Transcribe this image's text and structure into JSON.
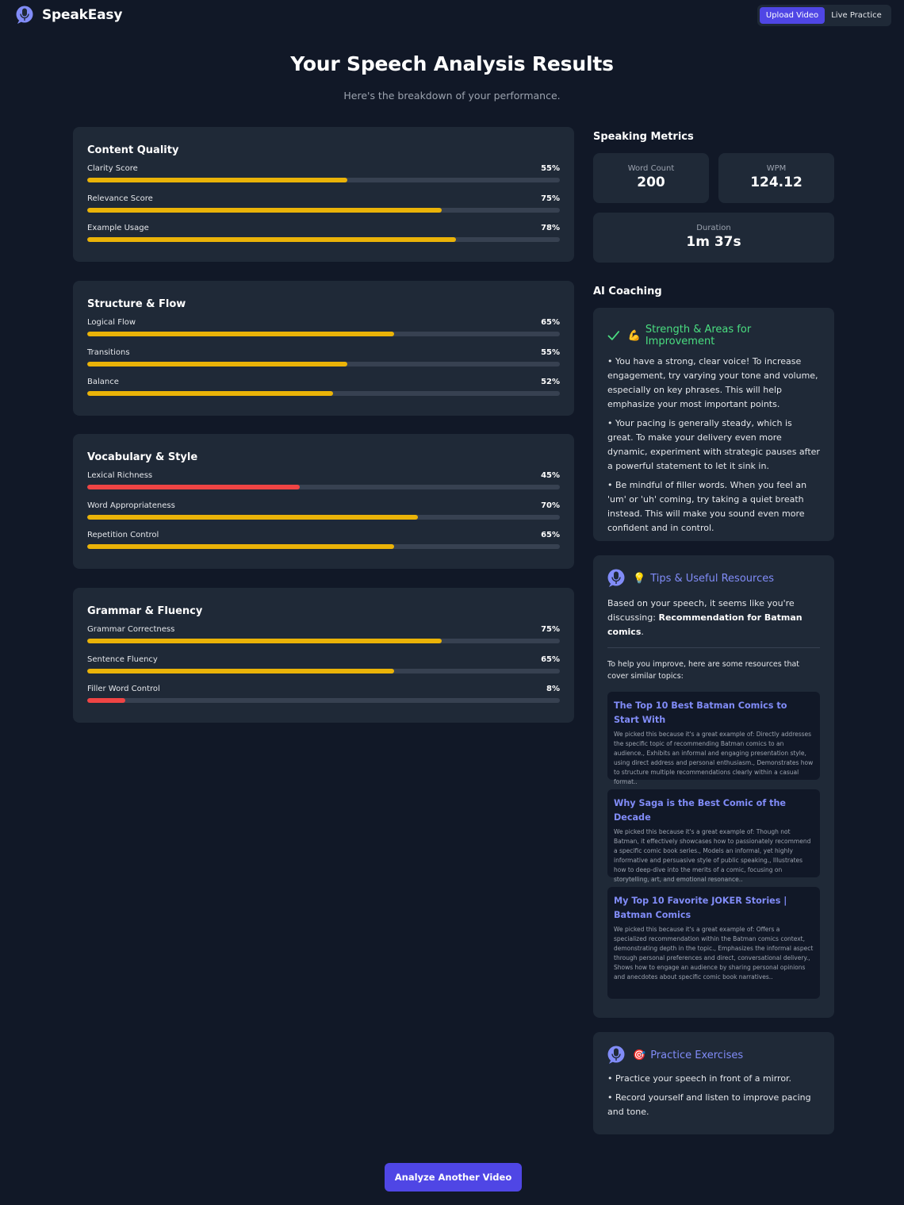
{
  "header": {
    "app_name": "SpeakEasy",
    "nav": [
      {
        "label": "Upload Video",
        "active": true
      },
      {
        "label": "Live Practice",
        "active": false
      }
    ]
  },
  "page": {
    "title": "Your Speech Analysis Results",
    "subtitle": "Here's the breakdown of your performance."
  },
  "colors": {
    "accent": "#4f46e5",
    "bar_ok": "#eab308",
    "bar_low": "#ef4444",
    "good": "#4ade80",
    "link": "#818cf8"
  },
  "score_cards": [
    {
      "title": "Content Quality",
      "metrics": [
        {
          "label": "Clarity Score",
          "value": 55,
          "display": "55%",
          "level": "ok"
        },
        {
          "label": "Relevance Score",
          "value": 75,
          "display": "75%",
          "level": "ok"
        },
        {
          "label": "Example Usage",
          "value": 78,
          "display": "78%",
          "level": "ok"
        }
      ]
    },
    {
      "title": "Structure & Flow",
      "metrics": [
        {
          "label": "Logical Flow",
          "value": 65,
          "display": "65%",
          "level": "ok"
        },
        {
          "label": "Transitions",
          "value": 55,
          "display": "55%",
          "level": "ok"
        },
        {
          "label": "Balance",
          "value": 52,
          "display": "52%",
          "level": "ok"
        }
      ]
    },
    {
      "title": "Vocabulary & Style",
      "metrics": [
        {
          "label": "Lexical Richness",
          "value": 45,
          "display": "45%",
          "level": "low"
        },
        {
          "label": "Word Appropriateness",
          "value": 70,
          "display": "70%",
          "level": "ok"
        },
        {
          "label": "Repetition Control",
          "value": 65,
          "display": "65%",
          "level": "ok"
        }
      ]
    },
    {
      "title": "Grammar & Fluency",
      "metrics": [
        {
          "label": "Grammar Correctness",
          "value": 75,
          "display": "75%",
          "level": "ok"
        },
        {
          "label": "Sentence Fluency",
          "value": 65,
          "display": "65%",
          "level": "ok"
        },
        {
          "label": "Filler Word Control",
          "value": 8,
          "display": "8%",
          "level": "low"
        }
      ]
    }
  ],
  "metrics_section": {
    "title": "Speaking Metrics",
    "word_count": {
      "label": "Word Count",
      "value": "200"
    },
    "wpm": {
      "label": "WPM",
      "value": "124.12"
    },
    "duration": {
      "label": "Duration",
      "value": "1m 37s"
    }
  },
  "coaching": {
    "title": "AI Coaching",
    "strength": {
      "icon": "check-icon",
      "emoji": "💪",
      "title": "Strength & Areas for Improvement",
      "bullets": [
        "• You have a strong, clear voice! To increase engagement, try varying your tone and volume, especially on key phrases. This will help emphasize your most important points.",
        "• Your pacing is generally steady, which is great. To make your delivery even more dynamic, experiment with strategic pauses after a powerful statement to let it sink in.",
        "• Be mindful of filler words. When you feel an 'um' or 'uh' coming, try taking a quiet breath instead. This will make you sound even more confident and in control."
      ]
    },
    "tips": {
      "icon": "microphone-icon",
      "emoji": "💡",
      "title": "Tips & Useful Resources",
      "intro_prefix": "Based on your speech, it seems like you're discussing: ",
      "topic": "Recommendation for Batman comics",
      "intro_suffix": ".",
      "resources_intro": "To help you improve, here are some resources that cover similar topics:",
      "resources": [
        {
          "title": "The Top 10 Best Batman Comics to Start With",
          "desc": "We picked this because it's a great example of: Directly addresses the specific topic of recommending Batman comics to an audience., Exhibits an informal and engaging presentation style, using direct address and personal enthusiasm., Demonstrates how to structure multiple recommendations clearly within a casual format.."
        },
        {
          "title": "Why Saga is the Best Comic of the Decade",
          "desc": "We picked this because it's a great example of: Though not Batman, it effectively showcases how to passionately recommend a specific comic book series., Models an informal, yet highly informative and persuasive style of public speaking., Illustrates how to deep-dive into the merits of a comic, focusing on storytelling, art, and emotional resonance.."
        },
        {
          "title": "My Top 10 Favorite JOKER Stories | Batman Comics",
          "desc": "We picked this because it's a great example of: Offers a specialized recommendation within the Batman comics context, demonstrating depth in the topic., Emphasizes the informal aspect through personal preferences and direct, conversational delivery., Shows how to engage an audience by sharing personal opinions and anecdotes about specific comic book narratives.."
        }
      ]
    },
    "practice": {
      "icon": "microphone-icon",
      "emoji": "🎯",
      "title": "Practice Exercises",
      "bullets": [
        "• Practice your speech in front of a mirror.",
        "• Record yourself and listen to improve pacing and tone."
      ]
    }
  },
  "cta": {
    "label": "Analyze Another Video"
  }
}
